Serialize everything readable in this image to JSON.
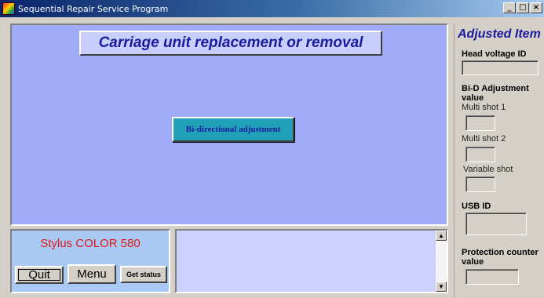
{
  "window": {
    "title": "Sequential Repair Service Program",
    "minimize_glyph": "_",
    "maximize_glyph": "□",
    "close_glyph": "×"
  },
  "main": {
    "heading": "Carriage unit replacement or removal",
    "action_button": "Bi-directional adjustment"
  },
  "adjusted": {
    "title": "Adjusted Item",
    "head_voltage_label": "Head voltage ID",
    "bid_label_1": "Bi-D Adjustment",
    "bid_label_2": "value",
    "multi_shot_1": "Multi shot 1",
    "multi_shot_2": "Multi shot 2",
    "variable_shot": "Variable shot",
    "usb_id_label": "USB ID",
    "protection_label_1": "Protection counter",
    "protection_label_2": "value"
  },
  "status": {
    "model": "Stylus COLOR 580",
    "quit_label": "Quit",
    "menu_label": "Menu",
    "get_status_label": "Get status"
  },
  "log": {
    "scroll_up": "▲",
    "scroll_down": "▼"
  },
  "colors": {
    "main_bg": "#9faaf8",
    "heading_text": "#1b1b9c",
    "action_button_bg": "#20a0b8",
    "model_text": "#e01818"
  }
}
